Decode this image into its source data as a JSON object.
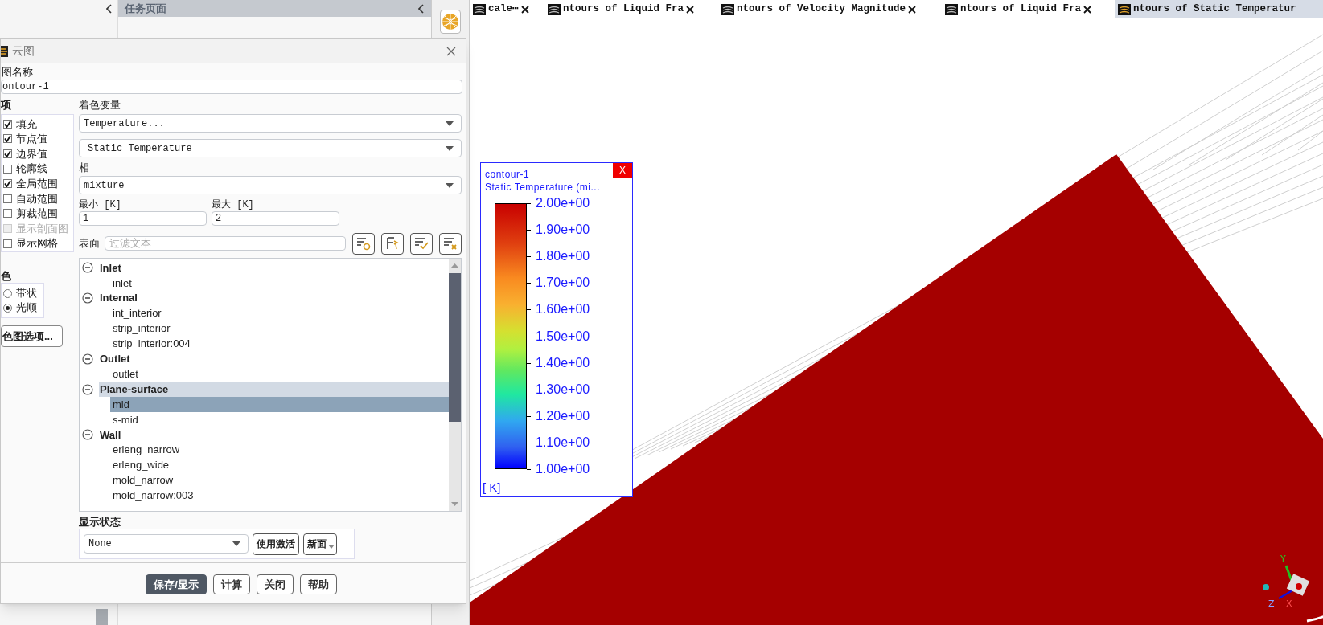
{
  "task_page": {
    "title": "任务页面"
  },
  "tabs": [
    {
      "label": "cale⋯",
      "selected": false
    },
    {
      "label": "ntours of Liquid Fra",
      "selected": false
    },
    {
      "label": "ntours of Velocity Magnitude",
      "selected": false
    },
    {
      "label": "ntours of Liquid Fra",
      "selected": false
    },
    {
      "label": "ntours of Static Temperatur",
      "selected": true
    }
  ],
  "dialog": {
    "title": "云图",
    "name_label": "图名称",
    "name_value": "ontour-1",
    "options_label": "项",
    "options": [
      {
        "label": "填充",
        "checked": true,
        "disabled": false
      },
      {
        "label": "节点值",
        "checked": true,
        "disabled": false
      },
      {
        "label": "边界值",
        "checked": true,
        "disabled": false
      },
      {
        "label": "轮廓线",
        "checked": false,
        "disabled": false
      },
      {
        "label": "全局范围",
        "checked": true,
        "disabled": false
      },
      {
        "label": "自动范围",
        "checked": false,
        "disabled": false
      },
      {
        "label": "剪裁范围",
        "checked": false,
        "disabled": false
      },
      {
        "label": "显示剖面图",
        "checked": false,
        "disabled": true
      },
      {
        "label": "显示网格",
        "checked": false,
        "disabled": false
      }
    ],
    "coloring_label": "色",
    "coloring": [
      {
        "label": "带状",
        "selected": false
      },
      {
        "label": "光顺",
        "selected": true
      }
    ],
    "colormap_button": "色图选项...",
    "variable_label": "着色变量",
    "variable": "Temperature...",
    "subvariable": "Static Temperature",
    "phase_label": "相",
    "phase": "mixture",
    "min_label": "最小 [K]",
    "min_value": "1",
    "max_label": "最大 [K]",
    "max_value": "2",
    "surfaces_label": "表面",
    "filter_placeholder": "过滤文本",
    "tree": [
      {
        "label": "Inlet",
        "expanded": true,
        "selected": false,
        "children": [
          {
            "label": "inlet",
            "selected": false
          }
        ]
      },
      {
        "label": "Internal",
        "expanded": true,
        "selected": false,
        "children": [
          {
            "label": "int_interior",
            "selected": false
          },
          {
            "label": "strip_interior",
            "selected": false
          },
          {
            "label": "strip_interior:004",
            "selected": false
          }
        ]
      },
      {
        "label": "Outlet",
        "expanded": true,
        "selected": false,
        "children": [
          {
            "label": "outlet",
            "selected": false
          }
        ]
      },
      {
        "label": "Plane-surface",
        "expanded": true,
        "selected": true,
        "children": [
          {
            "label": "mid",
            "selected": true
          },
          {
            "label": "s-mid",
            "selected": false
          }
        ]
      },
      {
        "label": "Wall",
        "expanded": true,
        "selected": false,
        "children": [
          {
            "label": "erleng_narrow",
            "selected": false
          },
          {
            "label": "erleng_wide",
            "selected": false
          },
          {
            "label": "mold_narrow",
            "selected": false
          },
          {
            "label": "mold_narrow:003",
            "selected": false
          }
        ]
      }
    ],
    "display_state_label": "显示状态",
    "display_state": "None",
    "use_active_button": "使用激活",
    "new_surface_button": "新面",
    "buttons": [
      {
        "label": "保存/显示",
        "primary": true
      },
      {
        "label": "计算",
        "primary": false
      },
      {
        "label": "关闭",
        "primary": false
      },
      {
        "label": "帮助",
        "primary": false
      }
    ]
  },
  "legend": {
    "title": "contour-1",
    "subtitle": "Static Temperature (mi...",
    "close": "X",
    "ticks": [
      "2.00e+00",
      "1.90e+00",
      "1.80e+00",
      "1.70e+00",
      "1.60e+00",
      "1.50e+00",
      "1.40e+00",
      "1.30e+00",
      "1.20e+00",
      "1.10e+00",
      "1.00e+00"
    ],
    "unit": "[ K]"
  },
  "triad": {
    "x": "X",
    "y": "Y",
    "z": "Z"
  }
}
